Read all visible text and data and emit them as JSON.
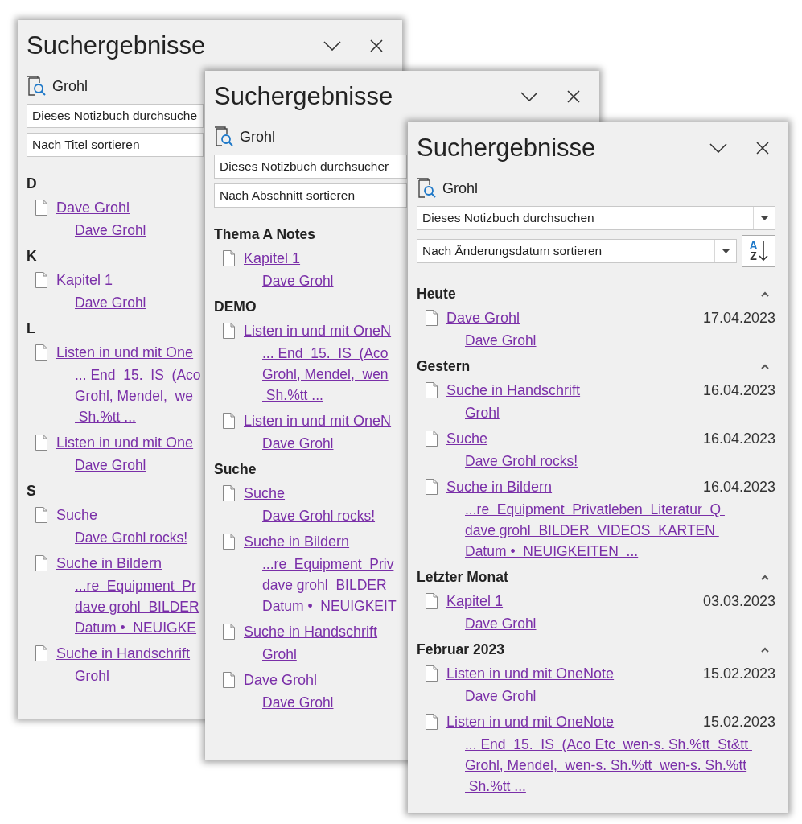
{
  "panels": [
    {
      "title": "Suchergebnisse",
      "query": "Grohl",
      "scope": "Dieses Notizbuch durchsuche",
      "sort": "Nach Titel sortieren",
      "groups": [
        {
          "heading": "D",
          "results": [
            {
              "title": "Dave Grohl",
              "snippet": [
                "Dave Grohl"
              ]
            }
          ]
        },
        {
          "heading": "K",
          "results": [
            {
              "title": "Kapitel 1",
              "snippet": [
                "Dave Grohl"
              ]
            }
          ]
        },
        {
          "heading": "L",
          "results": [
            {
              "title": "Listen in und mit One",
              "snippet": [
                "... End  15.  IS  (Aco",
                "Grohl, Mendel,  we",
                " Sh.%tt ..."
              ]
            },
            {
              "title": "Listen in und mit One",
              "snippet": [
                "Dave Grohl"
              ]
            }
          ]
        },
        {
          "heading": "S",
          "results": [
            {
              "title": "Suche",
              "snippet": [
                "Dave Grohl rocks!"
              ]
            },
            {
              "title": "Suche in Bildern",
              "snippet": [
                "...re  Equipment  Pr",
                "dave grohl  BILDER",
                "Datum •  NEUIGKE"
              ]
            },
            {
              "title": "Suche in Handschrift",
              "snippet": [
                "Grohl"
              ]
            }
          ]
        }
      ]
    },
    {
      "title": "Suchergebnisse",
      "query": "Grohl",
      "scope": "Dieses Notizbuch durchsucher",
      "sort": "Nach Abschnitt sortieren",
      "groups": [
        {
          "heading": "Thema A Notes",
          "results": [
            {
              "title": "Kapitel 1",
              "snippet": [
                "Dave Grohl"
              ]
            }
          ]
        },
        {
          "heading": "DEMO",
          "results": [
            {
              "title": "Listen in und mit OneN",
              "snippet": [
                "... End  15.  IS  (Aco",
                "Grohl, Mendel,  wen",
                " Sh.%tt ..."
              ]
            },
            {
              "title": "Listen in und mit OneN",
              "snippet": [
                "Dave Grohl"
              ]
            }
          ]
        },
        {
          "heading": "Suche",
          "results": [
            {
              "title": "Suche",
              "snippet": [
                "Dave Grohl rocks!"
              ]
            },
            {
              "title": "Suche in Bildern",
              "snippet": [
                "...re  Equipment  Priv",
                "dave grohl  BILDER",
                "Datum •  NEUIGKEIT"
              ]
            },
            {
              "title": "Suche in Handschrift",
              "snippet": [
                "Grohl"
              ]
            },
            {
              "title": "Dave Grohl",
              "snippet": [
                "Dave Grohl"
              ]
            }
          ]
        }
      ]
    },
    {
      "title": "Suchergebnisse",
      "query": "Grohl",
      "scope": "Dieses Notizbuch durchsuchen",
      "sort": "Nach Änderungsdatum sortieren",
      "sort_order": {
        "top": "A",
        "bottom": "Z"
      },
      "groups": [
        {
          "heading": "Heute",
          "expanded": true,
          "results": [
            {
              "title": "Dave Grohl",
              "date": "17.04.2023",
              "snippet": [
                "Dave Grohl"
              ]
            }
          ]
        },
        {
          "heading": "Gestern",
          "expanded": true,
          "results": [
            {
              "title": "Suche in Handschrift",
              "date": "16.04.2023",
              "snippet": [
                "Grohl"
              ]
            },
            {
              "title": "Suche",
              "date": "16.04.2023",
              "snippet": [
                "Dave Grohl rocks!"
              ]
            },
            {
              "title": "Suche in Bildern",
              "date": "16.04.2023",
              "snippet": [
                "...re  Equipment  Privatleben  Literatur  Q ",
                "dave grohl  BILDER  VIDEOS  KARTEN ",
                "Datum •  NEUIGKEITEN  ..."
              ]
            }
          ]
        },
        {
          "heading": "Letzter Monat",
          "expanded": true,
          "results": [
            {
              "title": "Kapitel 1",
              "date": "03.03.2023",
              "snippet": [
                "Dave Grohl"
              ]
            }
          ]
        },
        {
          "heading": "Februar 2023",
          "expanded": true,
          "results": [
            {
              "title": "Listen in und mit OneNote",
              "date": "15.02.2023",
              "snippet": [
                "Dave Grohl"
              ]
            },
            {
              "title": "Listen in und mit OneNote",
              "date": "15.02.2023",
              "snippet": [
                "... End  15.  IS  (Aco Etc  wen-s. Sh.%tt  St&tt ",
                "Grohl, Mendel,  wen-s. Sh.%tt  wen-s. Sh.%tt",
                " Sh.%tt ..."
              ]
            }
          ]
        }
      ]
    }
  ]
}
